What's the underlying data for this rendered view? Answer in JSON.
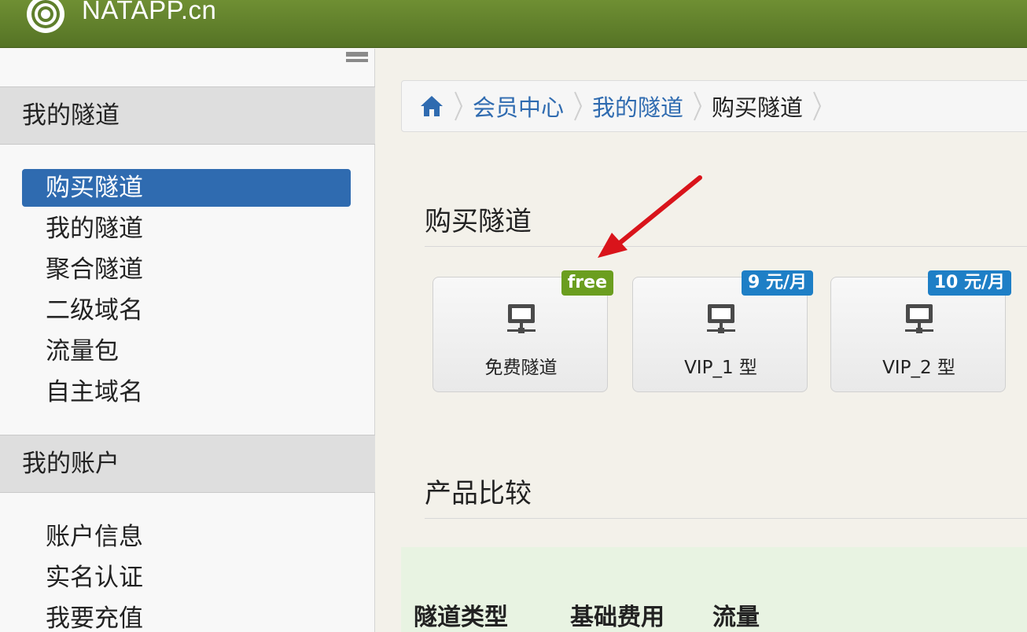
{
  "header": {
    "brand": "NATAPP.cn",
    "logo_icon": "target-logo-icon",
    "color": "#5f7f2c"
  },
  "sidebar": {
    "sections": [
      {
        "title": "我的隧道",
        "items": [
          {
            "label": "购买隧道",
            "active": true
          },
          {
            "label": "我的隧道"
          },
          {
            "label": "聚合隧道"
          },
          {
            "label": "二级域名"
          },
          {
            "label": "流量包"
          },
          {
            "label": "自主域名"
          }
        ]
      },
      {
        "title": "我的账户",
        "items": [
          {
            "label": "账户信息"
          },
          {
            "label": "实名认证"
          },
          {
            "label": "我要充值"
          }
        ]
      }
    ],
    "active_color": "#2f6bb0"
  },
  "breadcrumb": {
    "home_icon": "home-icon",
    "items": [
      "会员中心",
      "我的隧道",
      "购买隧道"
    ]
  },
  "main": {
    "buy_title": "购买隧道",
    "products": [
      {
        "badge": "free",
        "label": "免费隧道",
        "badge_color": "#6b9e1f",
        "icon": "monitor-network-icon"
      },
      {
        "badge": "9 元/月",
        "label": "VIP_1 型",
        "badge_color": "#1e7fc6",
        "icon": "monitor-network-icon"
      },
      {
        "badge": "10 元/月",
        "label": "VIP_2 型",
        "badge_color": "#1e7fc6",
        "icon": "monitor-network-icon"
      }
    ],
    "compare_title": "产品比较",
    "compare_headers": [
      "隧道类型",
      "基础费用",
      "流量"
    ]
  }
}
